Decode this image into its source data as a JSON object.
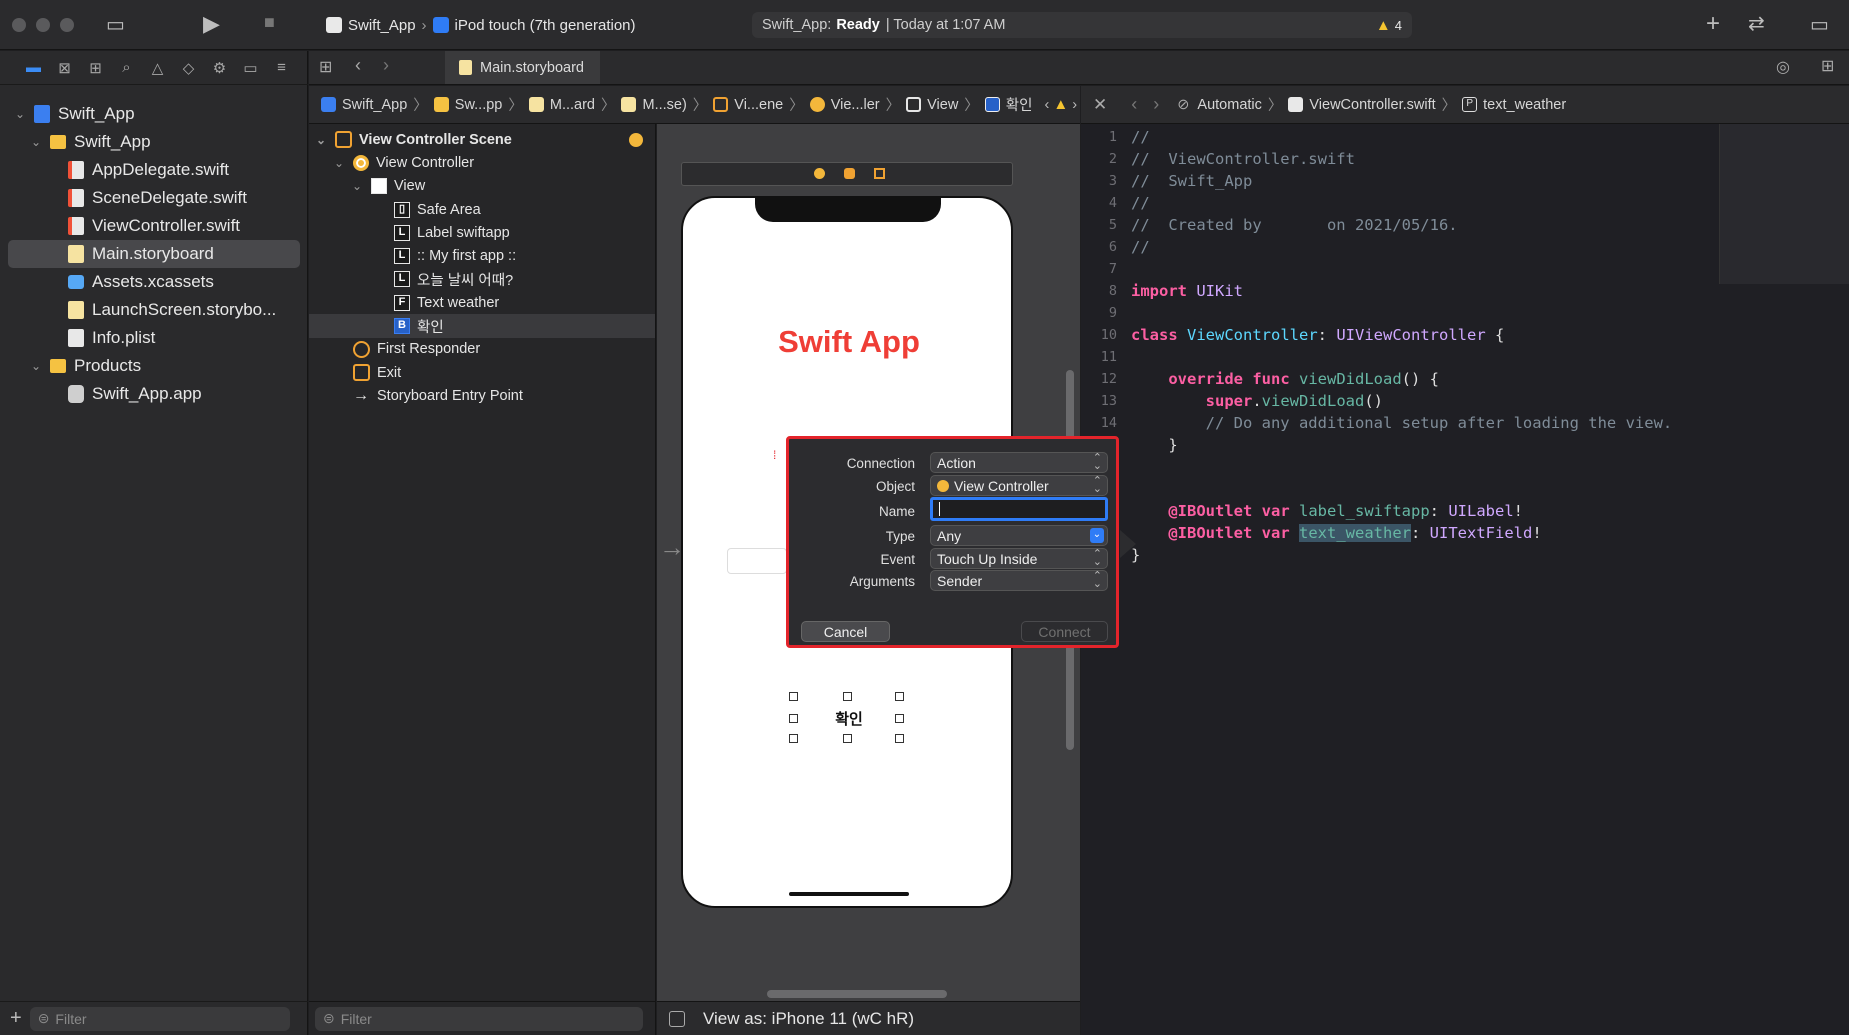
{
  "window": {
    "scheme_project": "Swift_App",
    "scheme_device": "iPod touch (7th generation)",
    "status_project": "Swift_App:",
    "status_state": "Ready",
    "status_time": "| Today at 1:07 AM",
    "warning_count": "4"
  },
  "navigator": {
    "items": [
      {
        "label": "Swift_App",
        "icon": "project-icon",
        "level": 0,
        "chevron": "down"
      },
      {
        "label": "Swift_App",
        "icon": "folder-icon",
        "level": 1,
        "chevron": "down"
      },
      {
        "label": "AppDelegate.swift",
        "icon": "swift-file-icon",
        "level": 2
      },
      {
        "label": "SceneDelegate.swift",
        "icon": "swift-file-icon",
        "level": 2
      },
      {
        "label": "ViewController.swift",
        "icon": "swift-file-icon",
        "level": 2
      },
      {
        "label": "Main.storyboard",
        "icon": "storyboard-file-icon",
        "level": 2,
        "selected": true
      },
      {
        "label": "Assets.xcassets",
        "icon": "assets-icon",
        "level": 2
      },
      {
        "label": "LaunchScreen.storybo...",
        "icon": "storyboard-file-icon",
        "level": 2
      },
      {
        "label": "Info.plist",
        "icon": "plist-file-icon",
        "level": 2
      },
      {
        "label": "Products",
        "icon": "folder-icon",
        "level": 1,
        "chevron": "down"
      },
      {
        "label": "Swift_App.app",
        "icon": "app-icon",
        "level": 2
      }
    ],
    "filter_placeholder": "Filter"
  },
  "tabs": {
    "active": "Main.storyboard"
  },
  "ib_jumpbar": [
    "Swift_App",
    "Sw...pp",
    "M...ard",
    "M...se)",
    "Vi...ene",
    "Vie...ler",
    "View",
    "확인"
  ],
  "code_jumpbar": [
    "Automatic",
    "ViewController.swift",
    "text_weather"
  ],
  "outline": {
    "scene": "View Controller Scene",
    "rows": [
      {
        "label": "View Controller",
        "badge": "vc"
      },
      {
        "label": "View",
        "badge": "view"
      },
      {
        "label": "Safe Area",
        "badge": "safe"
      },
      {
        "label": "Label swiftapp",
        "badge": "L"
      },
      {
        "label": ":: My first app ::",
        "badge": "L"
      },
      {
        "label": "오늘 날씨 어때?",
        "badge": "L"
      },
      {
        "label": "Text weather",
        "badge": "F"
      },
      {
        "label": "확인",
        "badge": "B"
      },
      {
        "label": "First Responder",
        "badge": "responder"
      },
      {
        "label": "Exit",
        "badge": "exit"
      },
      {
        "label": "Storyboard Entry Point",
        "badge": "arrow"
      }
    ],
    "filter_placeholder": "Filter"
  },
  "canvas": {
    "title_label": "Swift App",
    "button_label": "확인",
    "view_as": "View as: iPhone 11 (wC hR)"
  },
  "popover": {
    "connection_label": "Connection",
    "connection_value": "Action",
    "object_label": "Object",
    "object_value": "View Controller",
    "name_label": "Name",
    "name_value": "",
    "type_label": "Type",
    "type_value": "Any",
    "event_label": "Event",
    "event_value": "Touch Up Inside",
    "arguments_label": "Arguments",
    "arguments_value": "Sender",
    "cancel": "Cancel",
    "connect": "Connect"
  },
  "code": {
    "lines": [
      {
        "n": "1",
        "t": "//"
      },
      {
        "n": "2",
        "t": "//  ViewController.swift"
      },
      {
        "n": "3",
        "t": "//  Swift_App"
      },
      {
        "n": "4",
        "t": "//"
      },
      {
        "n": "5",
        "t": "//  Created by       on 2021/05/16."
      },
      {
        "n": "6",
        "t": "//"
      },
      {
        "n": "7",
        "t": ""
      },
      {
        "n": "8",
        "t": "import UIKit"
      },
      {
        "n": "9",
        "t": ""
      },
      {
        "n": "10",
        "t": "class ViewController: UIViewController {"
      },
      {
        "n": "11",
        "t": ""
      },
      {
        "n": "12",
        "t": "    override func viewDidLoad() {"
      },
      {
        "n": "13",
        "t": "        super.viewDidLoad()"
      },
      {
        "n": "14",
        "t": "        // Do any additional setup after loading the view."
      },
      {
        "n": "15",
        "t": "    }"
      },
      {
        "n": "16",
        "t": ""
      },
      {
        "n": "17",
        "t": ""
      },
      {
        "n": "18",
        "t": "    @IBOutlet var label_swiftapp: UILabel!"
      },
      {
        "n": "19",
        "t": "    @IBOutlet var text_weather: UITextField!"
      },
      {
        "n": "20",
        "t": "}"
      },
      {
        "n": "21",
        "t": ""
      },
      {
        "n": "22",
        "t": ""
      }
    ]
  },
  "colors": {
    "accent": "#3b8cf5",
    "popover_border": "#e3242b",
    "title_red": "#ef3e36"
  }
}
